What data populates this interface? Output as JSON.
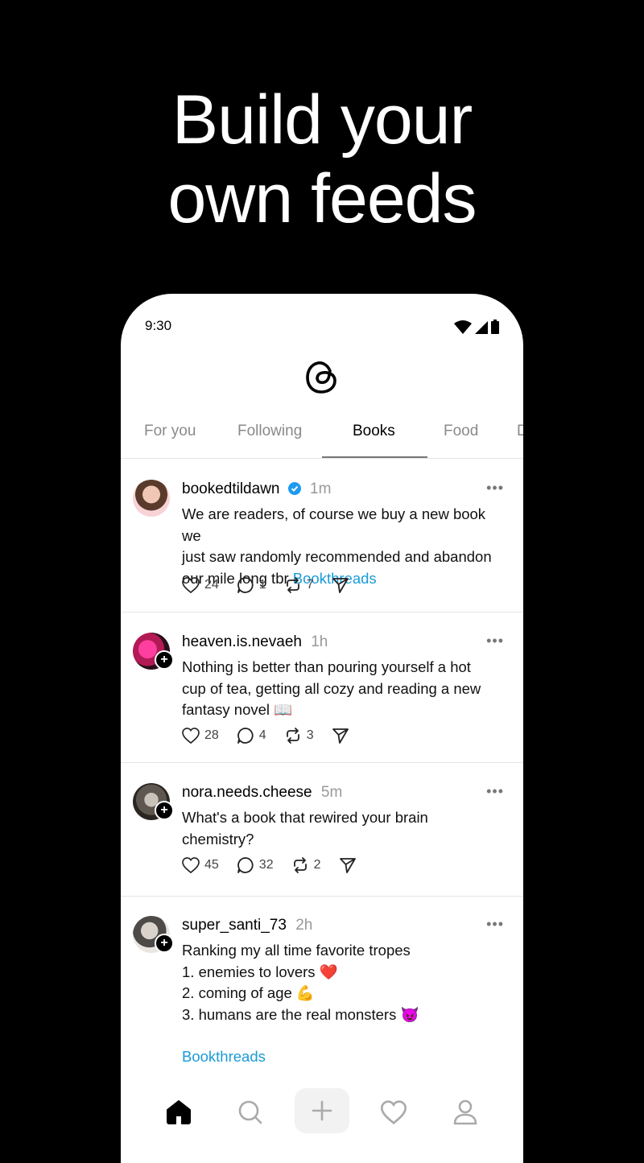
{
  "headline": {
    "line1": "Build your",
    "line2": "own feeds"
  },
  "status_bar": {
    "time": "9:30"
  },
  "tabs": [
    {
      "label": "For you",
      "active": false
    },
    {
      "label": "Following",
      "active": false
    },
    {
      "label": "Books",
      "active": true
    },
    {
      "label": "Food",
      "active": false
    },
    {
      "label": "D",
      "active": false
    }
  ],
  "posts": [
    {
      "username": "bookedtildawn",
      "verified": true,
      "time": "1m",
      "text_lines": [
        "We are readers, of course we buy a new book we",
        "just saw randomly recommended and abandon",
        "our mile long tbr"
      ],
      "link": "Bookthreads",
      "likes": "24",
      "replies": "1",
      "reposts": "7"
    },
    {
      "username": "heaven.is.nevaeh",
      "verified": false,
      "time": "1h",
      "text_lines": [
        "Nothing is better than pouring yourself a hot",
        "cup of tea, getting all cozy and reading a new",
        "fantasy novel 📖"
      ],
      "likes": "28",
      "replies": "4",
      "reposts": "3"
    },
    {
      "username": "nora.needs.cheese",
      "verified": false,
      "time": "5m",
      "text_lines": [
        "What's a book that rewired your brain",
        "chemistry?"
      ],
      "likes": "45",
      "replies": "32",
      "reposts": "2"
    },
    {
      "username": "super_santi_73",
      "verified": false,
      "time": "2h",
      "text_lines": [
        "Ranking my all time favorite tropes",
        "1. enemies to lovers ❤️",
        "2. coming of age 💪",
        "3. humans are the real monsters 😈"
      ],
      "link": "Bookthreads"
    }
  ],
  "colors": {
    "link": "#1a9bd7",
    "background": "#000000",
    "verified": "#1d9bf0"
  },
  "icons": [
    "threads-logo-icon",
    "heart-icon",
    "reply-icon",
    "repost-icon",
    "share-icon",
    "home-icon",
    "search-icon",
    "compose-icon",
    "activity-icon",
    "profile-icon"
  ]
}
